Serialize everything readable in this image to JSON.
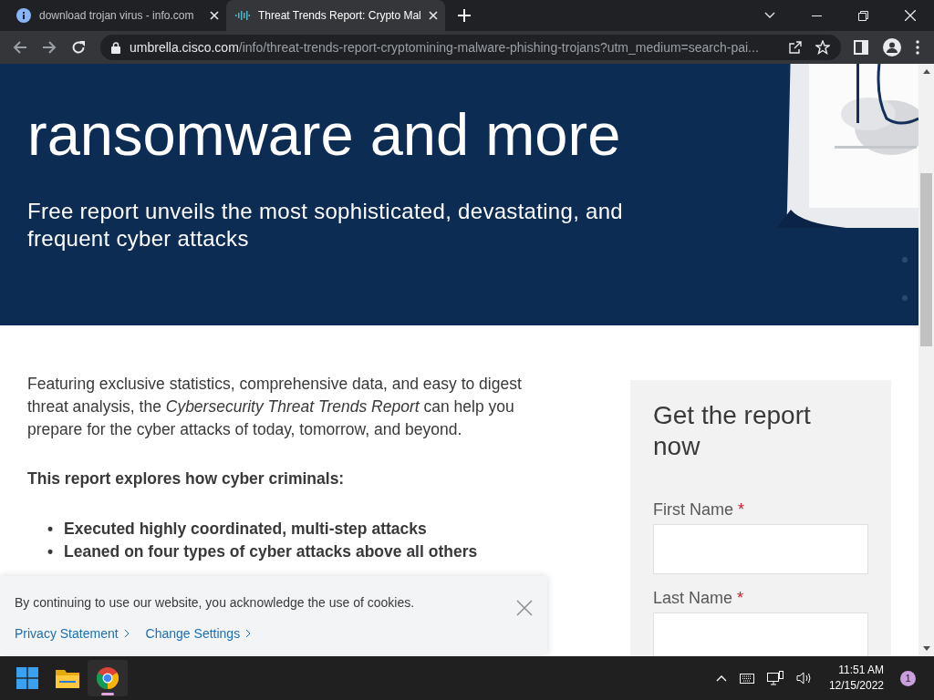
{
  "browser": {
    "tabs": [
      {
        "title": "download trojan virus - info.com",
        "selected": false
      },
      {
        "title": "Threat Trends Report: Crypto Mal",
        "selected": true
      }
    ],
    "url": {
      "host": "umbrella.cisco.com",
      "path": "/info/threat-trends-report-cryptomining-malware-phishing-trojans?utm_medium=search-pai..."
    }
  },
  "hero": {
    "heading_lines": [
      "ransomware and more"
    ],
    "subtitle": "Free report unveils the most sophisticated, devastating, and frequent cyber attacks"
  },
  "intro": "Featuring exclusive statistics, comprehensive data, and easy to digest threat analysis, the *Cybersecurity Threat Trends Report* can help you prepare for the cyber attacks of today, tomorrow, and beyond.",
  "list_heading": "This report explores how cyber criminals:",
  "bullets": [
    {
      "marker": "•",
      "text": "Executed highly coordinated, multi-step attacks"
    },
    {
      "marker": "•",
      "text": "Leaned on four types of cyber attacks above all others"
    }
  ],
  "form": {
    "title": "Get the report now",
    "fields": [
      {
        "label": "First Name",
        "marker": "*"
      },
      {
        "label": "Last Name",
        "marker": "*"
      }
    ]
  },
  "cookie_banner": {
    "message": "By continuing to use our website, you acknowledge the use of cookies.",
    "links": [
      "Privacy Statement",
      "Change Settings"
    ]
  },
  "taskbar": {
    "apps": [
      {
        "kind": "start",
        "selected": false
      },
      {
        "kind": "explorer",
        "selected": false
      },
      {
        "kind": "chrome",
        "selected": true
      }
    ],
    "time": "11:51 AM",
    "date": "12/15/2022",
    "notification_count": "1"
  }
}
